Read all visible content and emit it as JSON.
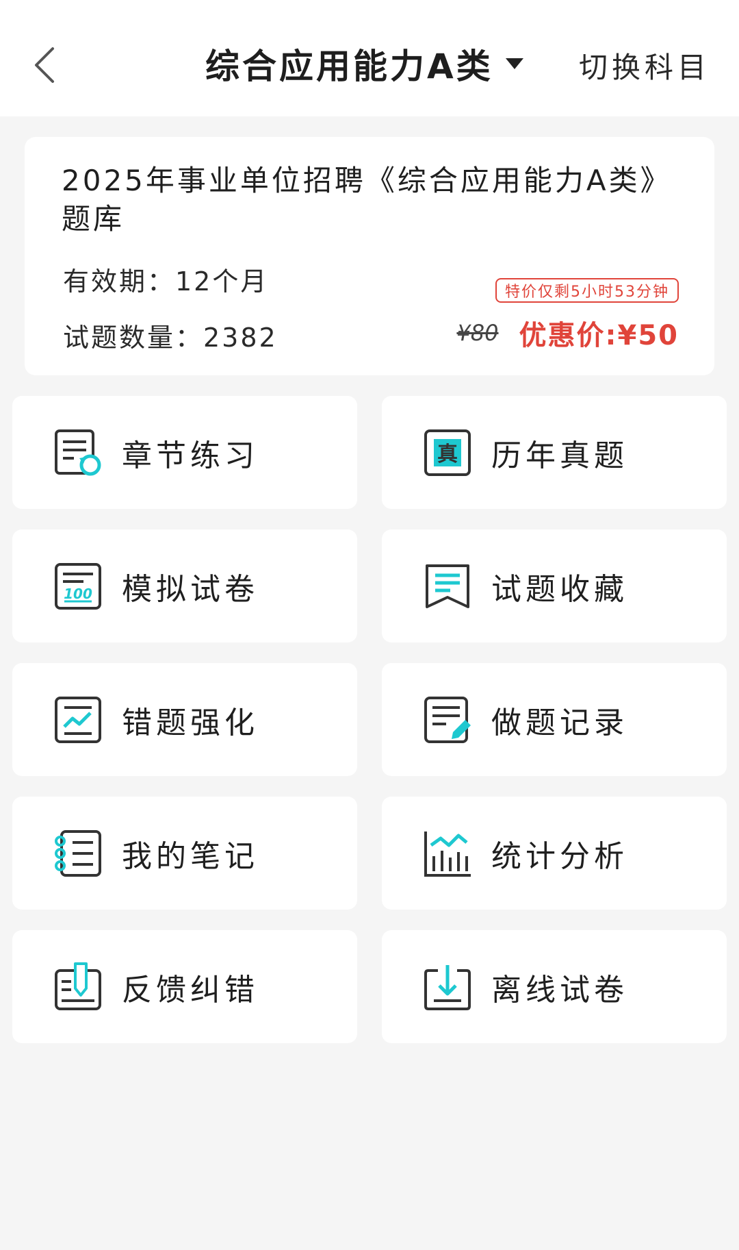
{
  "header": {
    "title": "综合应用能力A类",
    "switch_label": "切换科目"
  },
  "info": {
    "title": "2025年事业单位招聘《综合应用能力A类》题库",
    "validity": "有效期：12个月",
    "question_count": "试题数量：2382",
    "promo_tag": "特价仅剩5小时53分钟",
    "original_price": "¥80",
    "sale_price": "优惠价:¥50"
  },
  "menu": [
    {
      "label": "章节练习",
      "icon": "chapter-practice-icon"
    },
    {
      "label": "历年真题",
      "icon": "past-exams-icon"
    },
    {
      "label": "模拟试卷",
      "icon": "mock-exam-icon"
    },
    {
      "label": "试题收藏",
      "icon": "bookmark-icon"
    },
    {
      "label": "错题强化",
      "icon": "mistake-review-icon"
    },
    {
      "label": "做题记录",
      "icon": "practice-record-icon"
    },
    {
      "label": "我的笔记",
      "icon": "notebook-icon"
    },
    {
      "label": "统计分析",
      "icon": "statistics-icon"
    },
    {
      "label": "反馈纠错",
      "icon": "feedback-icon"
    },
    {
      "label": "离线试卷",
      "icon": "download-icon"
    }
  ],
  "colors": {
    "accent": "#1ec8d0",
    "icon_stroke": "#333333",
    "price_red": "#e0443a"
  }
}
